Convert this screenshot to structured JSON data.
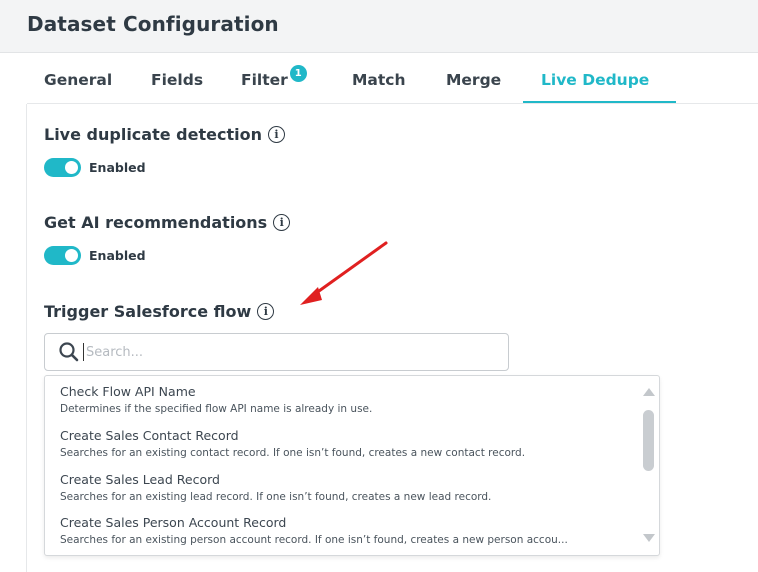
{
  "header": {
    "title": "Dataset Configuration"
  },
  "tabs": [
    {
      "label": "General",
      "active": false
    },
    {
      "label": "Fields",
      "active": false
    },
    {
      "label": "Filter",
      "active": false,
      "badge": "1"
    },
    {
      "label": "Match",
      "active": false
    },
    {
      "label": "Merge",
      "active": false
    },
    {
      "label": "Live Dedupe",
      "active": true
    }
  ],
  "sections": {
    "live_duplicate": {
      "title": "Live duplicate detection",
      "toggle_label": "Enabled",
      "enabled": true
    },
    "ai_recommendations": {
      "title": "Get AI recommendations",
      "toggle_label": "Enabled",
      "enabled": true
    },
    "salesforce_flow": {
      "title": "Trigger Salesforce flow"
    }
  },
  "search": {
    "placeholder": "Search...",
    "value": ""
  },
  "options": [
    {
      "title": "Check Flow API Name",
      "description": "Determines if the specified flow API name is already in use."
    },
    {
      "title": "Create Sales Contact Record",
      "description": "Searches for an existing contact record. If one isn’t found, creates a new contact record."
    },
    {
      "title": "Create Sales Lead Record",
      "description": "Searches for an existing lead record. If one isn’t found, creates a new lead record."
    },
    {
      "title": "Create Sales Person Account Record",
      "description": "Searches for an existing person account record. If one isn’t found, creates a new person accou..."
    }
  ],
  "icons": {
    "info": "info-icon",
    "search": "search-icon",
    "annotation": "red-arrow-annotation"
  },
  "colors": {
    "accent": "#20b8c8",
    "annotation": "#e02020",
    "text": "#2f3a44"
  }
}
